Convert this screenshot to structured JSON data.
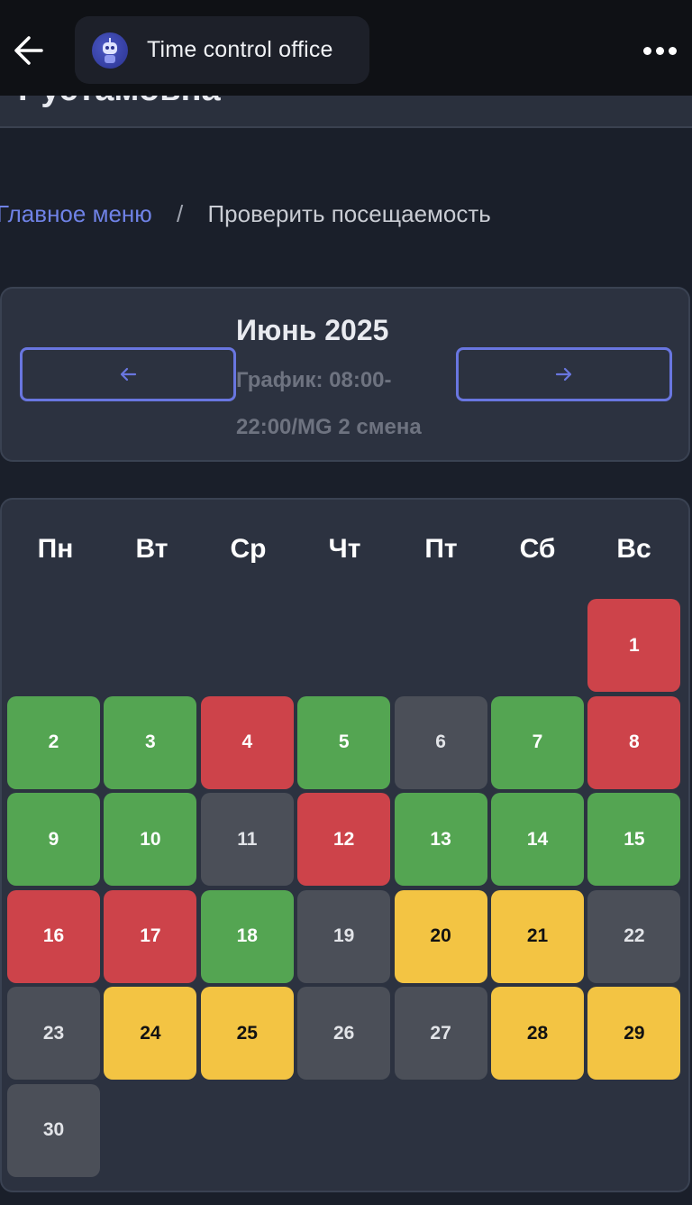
{
  "app_bar": {
    "title": "Time control office",
    "icons": {
      "back": "arrow-left-icon",
      "avatar": "robot-avatar-icon",
      "more": "more-horizontal-icon"
    }
  },
  "user_card": {
    "name_partial": "Рустамовна"
  },
  "breadcrumb": {
    "home": "Главное меню",
    "separator": "/",
    "current": "Проверить посещаемость"
  },
  "month": {
    "title": "Июнь 2025",
    "schedule": "График: 08:00-22:00/MG 2 смена",
    "prev_icon": "arrow-left-icon",
    "next_icon": "arrow-right-icon"
  },
  "calendar": {
    "weekdays": [
      "Пн",
      "Вт",
      "Ср",
      "Чт",
      "Пт",
      "Сб",
      "Вс"
    ],
    "first_weekday_index": 6,
    "days": [
      {
        "d": "1",
        "status": "red"
      },
      {
        "d": "2",
        "status": "green"
      },
      {
        "d": "3",
        "status": "green"
      },
      {
        "d": "4",
        "status": "red"
      },
      {
        "d": "5",
        "status": "green"
      },
      {
        "d": "6",
        "status": "gray"
      },
      {
        "d": "7",
        "status": "green"
      },
      {
        "d": "8",
        "status": "red"
      },
      {
        "d": "9",
        "status": "green"
      },
      {
        "d": "10",
        "status": "green"
      },
      {
        "d": "11",
        "status": "gray"
      },
      {
        "d": "12",
        "status": "red"
      },
      {
        "d": "13",
        "status": "green"
      },
      {
        "d": "14",
        "status": "green"
      },
      {
        "d": "15",
        "status": "green"
      },
      {
        "d": "16",
        "status": "red"
      },
      {
        "d": "17",
        "status": "red"
      },
      {
        "d": "18",
        "status": "green"
      },
      {
        "d": "19",
        "status": "gray"
      },
      {
        "d": "20",
        "status": "yellow"
      },
      {
        "d": "21",
        "status": "yellow"
      },
      {
        "d": "22",
        "status": "gray"
      },
      {
        "d": "23",
        "status": "gray"
      },
      {
        "d": "24",
        "status": "yellow"
      },
      {
        "d": "25",
        "status": "yellow"
      },
      {
        "d": "26",
        "status": "gray"
      },
      {
        "d": "27",
        "status": "gray"
      },
      {
        "d": "28",
        "status": "yellow"
      },
      {
        "d": "29",
        "status": "yellow"
      },
      {
        "d": "30",
        "status": "gray"
      }
    ],
    "colors": {
      "green": "#54a552",
      "red": "#cd434a",
      "gray": "#4b4f58",
      "yellow": "#f3c443"
    }
  }
}
